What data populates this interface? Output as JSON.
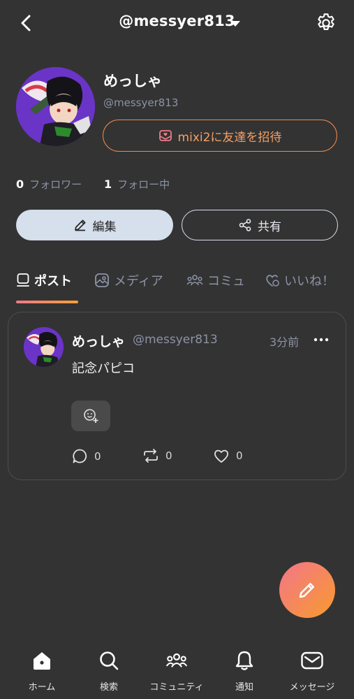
{
  "header": {
    "title": "@messyer813",
    "back_icon": "chevron-left-icon",
    "dropdown_icon": "caret-down-icon",
    "settings_icon": "gear-icon"
  },
  "profile": {
    "name": "めっしゃ",
    "handle": "@messyer813",
    "invite_label": "mixi2に友達を招待",
    "followers_count": "0",
    "followers_label": "フォロワー",
    "following_count": "1",
    "following_label": "フォロー中",
    "edit_label": "編集",
    "share_label": "共有"
  },
  "tabs": [
    {
      "label": "ポスト",
      "icon": "post-icon",
      "active": true
    },
    {
      "label": "メディア",
      "icon": "image-icon",
      "active": false
    },
    {
      "label": "コミュ",
      "icon": "community-icon",
      "active": false
    },
    {
      "label": "いいね！",
      "icon": "like-icon",
      "active": false
    }
  ],
  "post": {
    "author_name": "めっしゃ",
    "author_handle": "@messyer813",
    "time": "3分前",
    "body": "記念パピコ",
    "reply_count": "0",
    "repost_count": "0",
    "like_count": "0"
  },
  "bottom_nav": [
    {
      "label": "ホーム",
      "icon": "home-icon"
    },
    {
      "label": "検索",
      "icon": "search-icon"
    },
    {
      "label": "コミュニティ",
      "icon": "community-icon"
    },
    {
      "label": "通知",
      "icon": "bell-icon"
    },
    {
      "label": "メッセージ",
      "icon": "mail-icon"
    }
  ],
  "colors": {
    "background": "#333333",
    "accent_start": "#f3768a",
    "accent_end": "#f79a2e",
    "muted_text": "#8c93a6",
    "edit_button": "#d6dfec"
  }
}
